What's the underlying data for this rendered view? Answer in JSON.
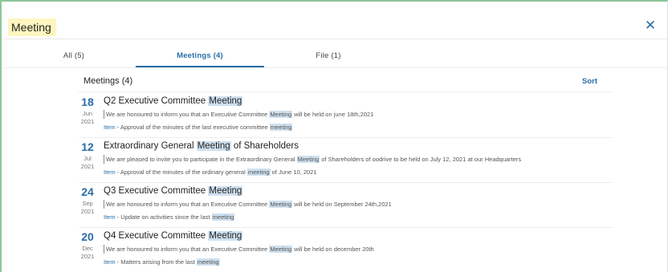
{
  "search": {
    "term": "Meeting"
  },
  "close_icon": "close-icon",
  "tabs": [
    {
      "label": "All (5)",
      "active": false
    },
    {
      "label": "Meetings (4)",
      "active": true
    },
    {
      "label": "File (1)",
      "active": false
    }
  ],
  "section": {
    "title": "Meetings (4)",
    "sort_label": "Sort"
  },
  "results": [
    {
      "day": "18",
      "month": "Jun",
      "year": "2021",
      "title_pre": "Q2 Executive Committee ",
      "title_hl": "Meeting",
      "title_post": "",
      "desc_pre": "We are honoured to inform you that an Executive Committee ",
      "desc_hl": "Meeting",
      "desc_post": " will be held on june 18th,2021",
      "item_label": "Item",
      "item_pre": " - Approval of the minutes of the last executive committee ",
      "item_hl": "meeting"
    },
    {
      "day": "12",
      "month": "Jul",
      "year": "2021",
      "title_pre": "Extraordinary General ",
      "title_hl": "Meeting",
      "title_post": " of Shareholders",
      "desc_pre": "We are pleased to invite you to participate in the Extraordinary General ",
      "desc_hl": "Meeting",
      "desc_post": " of Shareholders of oodrive to be held on July 12, 2021 at our Headquarters",
      "item_label": "Item",
      "item_pre": " - Approval of the minutes of the ordinary general ",
      "item_hl": "meeting",
      "item_post": " of June 10, 2021"
    },
    {
      "day": "24",
      "month": "Sep",
      "year": "2021",
      "title_pre": "Q3 Executive Committee ",
      "title_hl": "Meeting",
      "title_post": "",
      "desc_pre": "We are honoured to inform you that an Executive Committee ",
      "desc_hl": "Meeting",
      "desc_post": " will be held on September 24th,2021",
      "item_label": "Item",
      "item_pre": " - Update on activities since the last ",
      "item_hl": "meeting"
    },
    {
      "day": "20",
      "month": "Dec",
      "year": "2021",
      "title_pre": "Q4 Executive Committee ",
      "title_hl": "Meeting",
      "title_post": "",
      "desc_pre": "We are honoured to inform you that an Executive Committee ",
      "desc_hl": "Meeting",
      "desc_post": " will be held on december 20th",
      "item_label": "Item",
      "item_pre": " - Matters arising from the last ",
      "item_hl": "meeting"
    }
  ],
  "colors": {
    "accent": "#2a6ea6",
    "highlight": "#cfe0ef",
    "search_highlight": "#fdf6bf",
    "frame": "#8fc59a"
  }
}
